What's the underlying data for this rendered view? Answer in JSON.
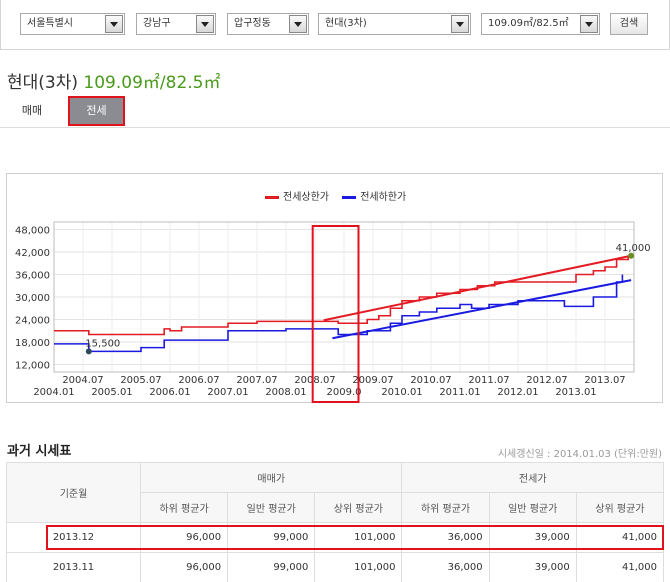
{
  "search": {
    "city": "서울특별시",
    "district": "강남구",
    "dong": "압구정동",
    "apartment": "현대(3차)",
    "area": "109.09㎡/82.5㎡",
    "button_label": "검색"
  },
  "header": {
    "name": "현대(3차)",
    "size": "109.09㎡/82.5㎡"
  },
  "tabs": [
    {
      "label": "매매",
      "selected": false
    },
    {
      "label": "전세",
      "selected": true
    }
  ],
  "chart_data": {
    "type": "line",
    "title": "",
    "legend_position": "top",
    "ylim": [
      10000,
      50000
    ],
    "yticks": [
      "48,000",
      "42,000",
      "36,000",
      "30,000",
      "24,000",
      "18,000",
      "12,000"
    ],
    "ytick_values": [
      48000,
      42000,
      36000,
      30000,
      24000,
      18000,
      12000
    ],
    "xticks_top": [
      "2004.07",
      "2005.07",
      "2006.07",
      "2007.07",
      "2008.07",
      "2009.07",
      "2010.07",
      "2011.07",
      "2012.07",
      "2013.07"
    ],
    "xticks_bottom": [
      "2004.01",
      "2005.01",
      "2006.01",
      "2007.01",
      "2008.01",
      "2009.0",
      "2010.01",
      "2011.01",
      "2012.01",
      "2013.01"
    ],
    "series": [
      {
        "name": "전세상한가",
        "color": "#e31b23",
        "x": [
          2004.0,
          2004.5,
          2004.6,
          2005.1,
          2005.2,
          2005.8,
          2005.9,
          2006.0,
          2006.2,
          2006.3,
          2006.5,
          2006.9,
          2007.0,
          2007.5,
          2008.0,
          2008.5,
          2008.7,
          2008.9,
          2009.0,
          2009.3,
          2009.4,
          2009.6,
          2009.8,
          2010.0,
          2010.3,
          2010.6,
          2011.0,
          2011.3,
          2011.6,
          2012.0,
          2012.5,
          2013.0,
          2013.3,
          2013.5,
          2013.7,
          2013.9
        ],
        "values": [
          21000,
          21000,
          20000,
          20000,
          20000,
          20000,
          21500,
          21000,
          22000,
          22000,
          22000,
          22000,
          23000,
          23500,
          23500,
          23500,
          23500,
          23000,
          23000,
          23000,
          24000,
          25000,
          27000,
          29000,
          30000,
          31000,
          32000,
          33000,
          34000,
          34000,
          34000,
          36000,
          37000,
          38000,
          40000,
          41000
        ]
      },
      {
        "name": "전세하한가",
        "color": "#1a1ae0",
        "x": [
          2004.0,
          2004.3,
          2004.6,
          2005.0,
          2005.1,
          2005.5,
          2005.9,
          2006.0,
          2006.5,
          2006.8,
          2007.0,
          2007.5,
          2008.0,
          2008.4,
          2008.7,
          2008.9,
          2009.2,
          2009.4,
          2009.6,
          2009.8,
          2010.0,
          2010.3,
          2010.6,
          2011.0,
          2011.2,
          2011.5,
          2012.0,
          2012.5,
          2012.8,
          2013.0,
          2013.3,
          2013.5,
          2013.7,
          2013.8
        ],
        "values": [
          17500,
          17500,
          15500,
          15500,
          15500,
          16500,
          18500,
          18500,
          18500,
          18500,
          21000,
          21000,
          21500,
          21500,
          21500,
          20000,
          20000,
          21000,
          21000,
          23000,
          25000,
          26000,
          27000,
          28000,
          27000,
          28000,
          29000,
          29000,
          27500,
          27500,
          30000,
          30000,
          34000,
          36000
        ]
      }
    ],
    "trendlines": [
      {
        "series": "전세상한가",
        "x": [
          2008.65,
          2013.95
        ],
        "values": [
          23800,
          41000
        ]
      },
      {
        "series": "전세하한가",
        "x": [
          2008.8,
          2013.95
        ],
        "values": [
          19000,
          34500
        ]
      }
    ],
    "annotations": [
      {
        "text": "15,500",
        "x": 2004.6,
        "y": 15500
      },
      {
        "text": "41,000",
        "x": 2013.95,
        "y": 41000
      }
    ]
  },
  "history": {
    "title": "과거 시세표",
    "meta": "시세갱신일 : 2014.01.03 (단위:만원)",
    "col_base": "기준월",
    "group_sale": "매매가",
    "group_jeonse": "전세가",
    "sub_headers": [
      "하위 평균가",
      "일반 평균가",
      "상위 평균가",
      "하위 평균가",
      "일반 평균가",
      "상위 평균가"
    ],
    "rows": [
      {
        "month": "2013.12",
        "values": [
          "96,000",
          "99,000",
          "101,000",
          "36,000",
          "39,000",
          "41,000"
        ]
      },
      {
        "month": "2013.11",
        "values": [
          "96,000",
          "99,000",
          "101,000",
          "36,000",
          "39,000",
          "41,000"
        ]
      }
    ]
  }
}
